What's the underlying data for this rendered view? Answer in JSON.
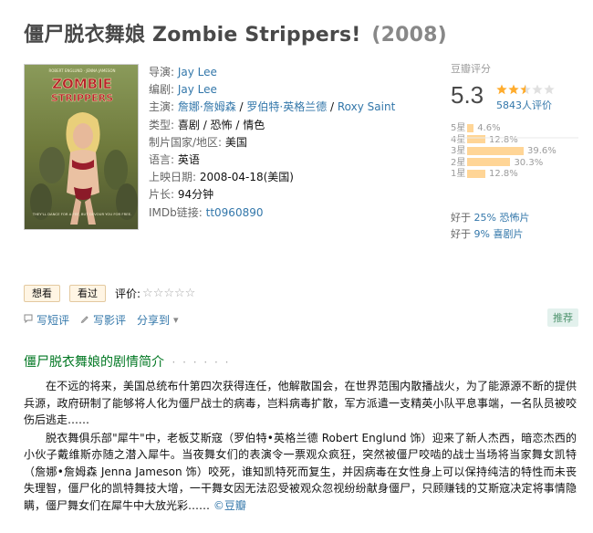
{
  "title": "僵尸脱衣舞娘 Zombie Strippers!",
  "year": "(2008)",
  "poster": {
    "credit_top": "ROBERT ENGLUND · JENNA JAMESON",
    "title_line1": "ZOMBIE",
    "title_line2": "STRIPPERS",
    "tagline": "THEY'LL DANCE FOR A FEE, BUT DEVOUR YOU FOR FREE."
  },
  "info": {
    "director_label": "导演:",
    "director": "Jay Lee",
    "writer_label": "编剧:",
    "writer": "Jay Lee",
    "cast_label": "主演:",
    "cast": [
      "詹娜·詹姆森",
      "罗伯特·英格兰德",
      "Roxy Saint"
    ],
    "genre_label": "类型:",
    "genre": "喜剧 / 恐怖 / 情色",
    "country_label": "制片国家/地区:",
    "country": "美国",
    "language_label": "语言:",
    "language": "英语",
    "release_label": "上映日期:",
    "release": "2008-04-18(美国)",
    "runtime_label": "片长:",
    "runtime": "94分钟",
    "imdb_label": "IMDb链接:",
    "imdb": "tt0960890"
  },
  "rating": {
    "label": "豆瓣评分",
    "score": "5.3",
    "stars_filled": 2.5,
    "count": "5843人评价",
    "distribution": [
      {
        "label": "5星",
        "percent": "4.6%",
        "value": 4.6
      },
      {
        "label": "4星",
        "percent": "12.8%",
        "value": 12.8
      },
      {
        "label": "3星",
        "percent": "39.6%",
        "value": 39.6
      },
      {
        "label": "2星",
        "percent": "30.3%",
        "value": 30.3
      },
      {
        "label": "1星",
        "percent": "12.8%",
        "value": 12.8
      }
    ],
    "better_than": [
      {
        "prefix": "好于",
        "value": "25% 恐怖片"
      },
      {
        "prefix": "好于",
        "value": "9% 喜剧片"
      }
    ]
  },
  "actions": {
    "want": "想看",
    "watched": "看过",
    "rate_label": "评价:",
    "rate_stars": "☆☆☆☆☆"
  },
  "share": {
    "short_review": "写短评",
    "review": "写影评",
    "share_to": "分享到",
    "recommend": "推荐"
  },
  "synopsis": {
    "title": "僵尸脱衣舞娘的剧情简介",
    "dots": "· · · · · ·",
    "p1": "在不远的将来，美国总统布什第四次获得连任，他解散国会，在世界范围内散播战火，为了能源源不断的提供兵源，政府研制了能够将人化为僵尸战士的病毒，岂料病毒扩散，军方派遣一支精英小队平息事端，一名队员被咬伤后逃走……",
    "p2": "脱衣舞俱乐部\"犀牛\"中，老板艾斯寇（罗伯特•英格兰德 Robert Englund 饰）迎来了新人杰西，暗恋杰西的小伙子戴维斯亦随之潜入犀牛。当夜舞女们的表演令一票观众疯狂，突然被僵尸咬啮的战士当场将当家舞女凯特（詹娜•詹姆森 Jenna Jameson 饰）咬死，谁知凯特死而复生，并因病毒在女性身上可以保持纯洁的特性而未丧失理智，僵尸化的凯特舞技大增，一干舞女因无法忍受被观众忽视纷纷献身僵尸，只顾赚钱的艾斯寇决定将事情隐瞒，僵尸舞女们在犀牛中大放光彩……",
    "source": "©豆瓣"
  },
  "colors": {
    "link": "#3377aa",
    "star": "#ffac2d",
    "bar": "#ffd596",
    "section_title": "#007722"
  }
}
